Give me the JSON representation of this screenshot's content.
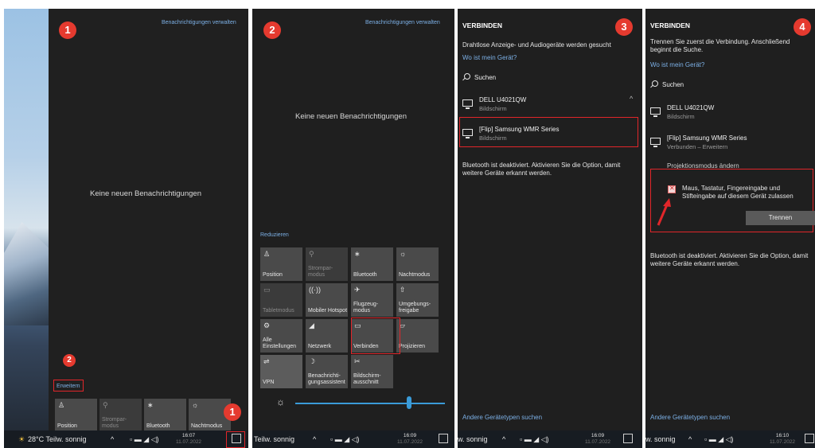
{
  "panel1": {
    "badge": "1",
    "manage_link": "Benachrichtigungen verwalten",
    "empty_text": "Keine neuen Benachrichtigungen",
    "expand_badge": "2",
    "expand_link": "Erweitern",
    "tiles": [
      {
        "icon": "position-icon",
        "label": "Position"
      },
      {
        "icon": "battery-saver-icon",
        "label": "Strompar-modus"
      },
      {
        "icon": "bluetooth-icon",
        "label": "Bluetooth"
      },
      {
        "icon": "night-mode-icon",
        "label": "Nachtmodus"
      }
    ],
    "notify_badge": "1",
    "taskbar": {
      "weather": "28°C Teilw. sonnig",
      "time": "16:07",
      "date": "11.07.2022"
    }
  },
  "panel2": {
    "badge": "2",
    "manage_link": "Benachrichtigungen verwalten",
    "empty_text": "Keine neuen Benachrichtigungen",
    "collapse_link": "Reduzieren",
    "tiles": [
      {
        "label": "Position",
        "glyph": "♙"
      },
      {
        "label": "Strompar-modus",
        "glyph": "⚲"
      },
      {
        "label": "Bluetooth",
        "glyph": "∗"
      },
      {
        "label": "Nachtmodus",
        "glyph": "☼"
      },
      {
        "label": "Tabletmodus",
        "glyph": "▭"
      },
      {
        "label": "Mobiler Hotspot",
        "glyph": "((·))"
      },
      {
        "label": "Flugzeug-modus",
        "glyph": "✈"
      },
      {
        "label": "Umgebungs-freigabe",
        "glyph": "⇧"
      },
      {
        "label": "Alle Einstellungen",
        "glyph": "⚙"
      },
      {
        "label": "Netzwerk",
        "glyph": "◢"
      },
      {
        "label": "Verbinden",
        "glyph": "▭"
      },
      {
        "label": "Projizieren",
        "glyph": "▱"
      },
      {
        "label": "VPN",
        "glyph": "⇌"
      },
      {
        "label": "Benachrichti-gungsassistent",
        "glyph": "☽"
      },
      {
        "label": "Bildschirm-ausschnitt",
        "glyph": "✂"
      }
    ],
    "taskbar": {
      "weather": "Teilw. sonnig",
      "time": "16:09",
      "date": "11.07.2022"
    }
  },
  "panel3": {
    "badge": "3",
    "header": "VERBINDEN",
    "intro": "Drahtlose Anzeige- und Audiogeräte werden gesucht",
    "where_link": "Wo ist mein Gerät?",
    "search": "Suchen",
    "devices": [
      {
        "name": "DELL U4021QW",
        "sub": "Bildschirm"
      },
      {
        "name": "[Flip] Samsung WMR Series",
        "sub": "Bildschirm"
      }
    ],
    "bt_note": "Bluetooth ist deaktiviert. Aktivieren Sie die Option, damit weitere Geräte erkannt werden.",
    "other_link": "Andere Gerätetypen suchen",
    "taskbar": {
      "weather": "w. sonnig",
      "time": "16:09",
      "date": "11.07.2022"
    }
  },
  "panel4": {
    "badge": "4",
    "header": "VERBINDEN",
    "intro": "Trennen Sie zuerst die Verbindung. Anschließend beginnt die Suche.",
    "where_link": "Wo ist mein Gerät?",
    "search": "Suchen",
    "devices": [
      {
        "name": "DELL U4021QW",
        "sub": "Bildschirm"
      },
      {
        "name": "[Flip] Samsung WMR Series",
        "sub": "Verbunden – Erweitern"
      }
    ],
    "projection_mode": "Projektionsmodus ändern",
    "allow_input": "Maus, Tastatur, Fingereingabe und Stifteingabe auf diesem Gerät zulassen",
    "disconnect": "Trennen",
    "bt_note": "Bluetooth ist deaktiviert. Aktivieren Sie die Option, damit weitere Geräte erkannt werden.",
    "other_link": "Andere Gerätetypen suchen",
    "taskbar": {
      "weather": "w. sonnig",
      "time": "16:10",
      "date": "11.07.2022"
    }
  },
  "colors": {
    "accent": "#7cb0e6",
    "highlight": "#e1262a",
    "panel": "#1f1f1f",
    "tile": "#4a4a4a"
  }
}
